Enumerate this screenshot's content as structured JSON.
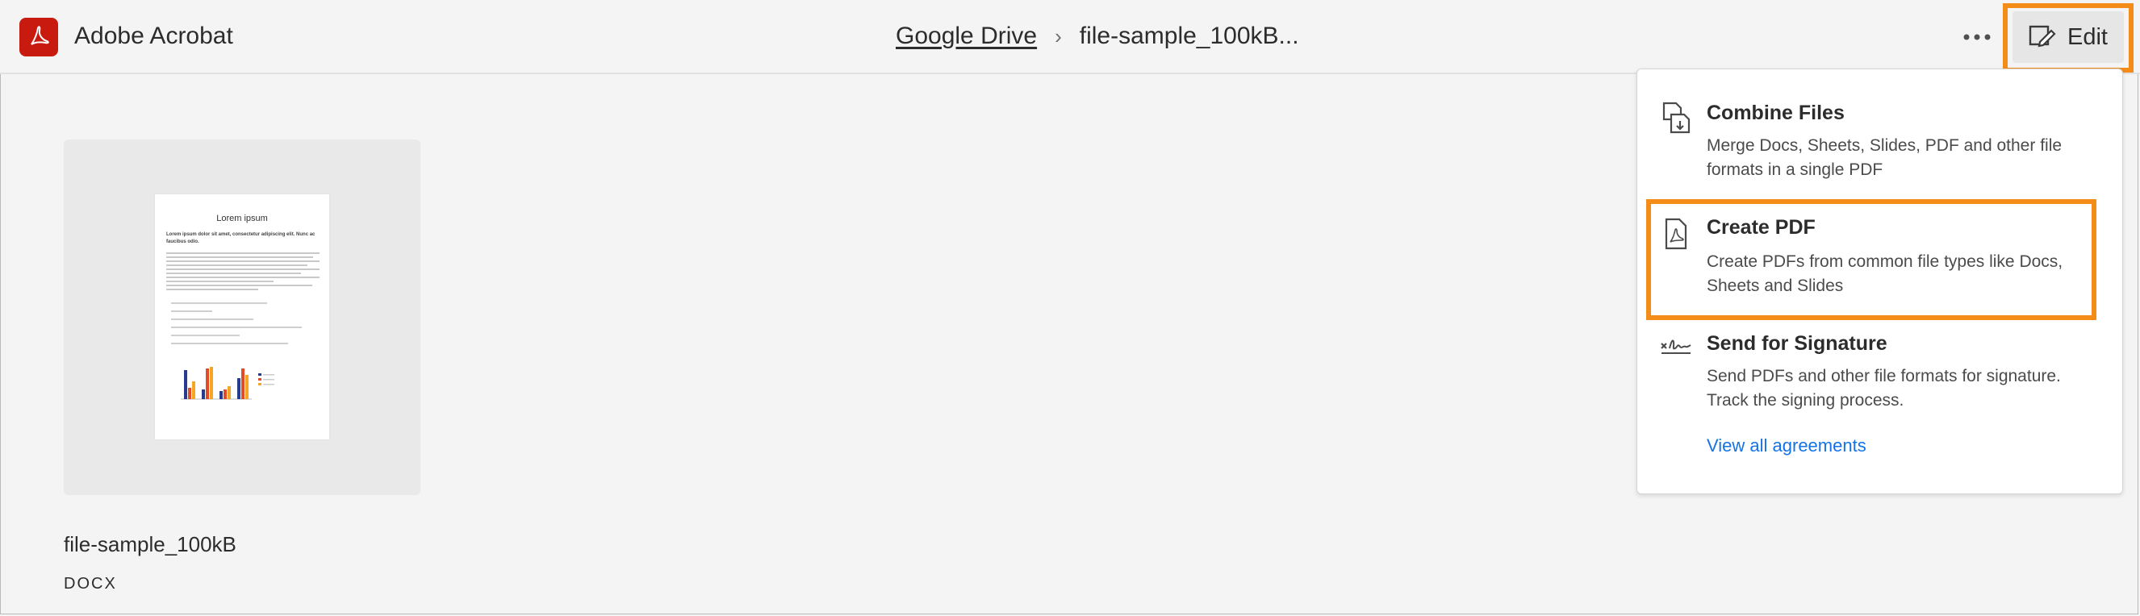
{
  "header": {
    "app_name": "Adobe Acrobat",
    "breadcrumb": {
      "parent": "Google Drive",
      "separator": "›",
      "current": "file-sample_100kB..."
    },
    "more_label": "•••",
    "edit_label": "Edit"
  },
  "file": {
    "name": "file-sample_100kB",
    "type": "DOCX",
    "preview": {
      "title": "Lorem ipsum",
      "subtitle": "Lorem ipsum dolor sit amet, consectetur adipiscing elit. Nunc ac faucibus odio."
    }
  },
  "menu": {
    "items": [
      {
        "title": "Combine Files",
        "description": "Merge Docs, Sheets, Slides, PDF and other file formats in a single PDF",
        "icon": "combine-files-icon"
      },
      {
        "title": "Create PDF",
        "description": "Create PDFs from common file types like Docs, Sheets and Slides",
        "icon": "create-pdf-icon"
      },
      {
        "title": "Send for Signature",
        "description": "Send PDFs and other file formats for signature. Track the signing process.",
        "icon": "signature-icon"
      }
    ],
    "view_all": "View all agreements"
  },
  "colors": {
    "brand": "#c91a10",
    "highlight": "#f48c1a",
    "link": "#1473e6"
  }
}
